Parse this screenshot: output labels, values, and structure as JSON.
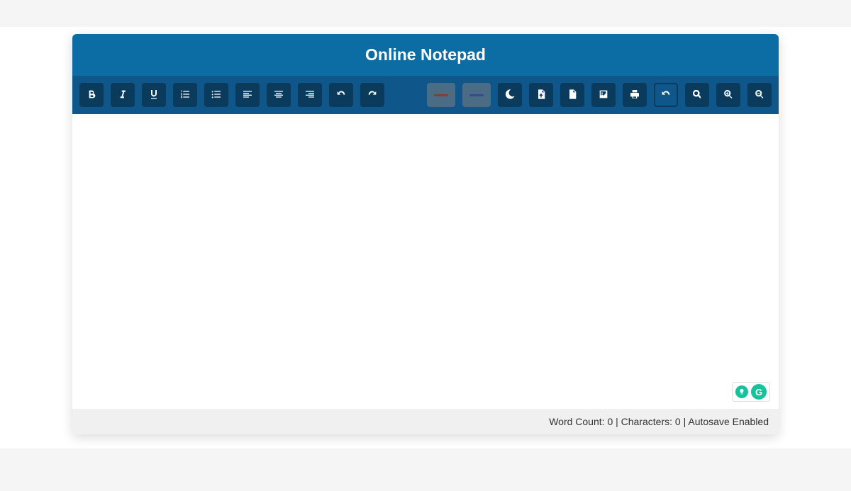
{
  "header": {
    "title": "Online Notepad"
  },
  "toolbar": {
    "left": [
      {
        "name": "bold-button",
        "icon": "bold-icon"
      },
      {
        "name": "italic-button",
        "icon": "italic-icon"
      },
      {
        "name": "underline-button",
        "icon": "underline-icon"
      },
      {
        "name": "ordered-list-button",
        "icon": "ordered-list-icon"
      },
      {
        "name": "unordered-list-button",
        "icon": "unordered-list-icon"
      },
      {
        "name": "align-left-button",
        "icon": "align-left-icon"
      },
      {
        "name": "align-center-button",
        "icon": "align-center-icon"
      },
      {
        "name": "align-right-button",
        "icon": "align-right-icon"
      },
      {
        "name": "undo-button",
        "icon": "undo-icon"
      },
      {
        "name": "redo-button",
        "icon": "redo-icon"
      }
    ],
    "right_colors": [
      {
        "name": "text-color-button",
        "icon": "text-color-icon",
        "swatch": "#8a3a3a"
      },
      {
        "name": "highlight-color-button",
        "icon": "highlight-color-icon",
        "swatch": "#3a4a8a"
      }
    ],
    "right": [
      {
        "name": "dark-mode-button",
        "icon": "moon-icon",
        "active": false
      },
      {
        "name": "download-txt-button",
        "icon": "file-download-icon",
        "active": false
      },
      {
        "name": "download-doc-button",
        "icon": "file-doc-icon",
        "active": false
      },
      {
        "name": "insert-image-button",
        "icon": "image-icon",
        "active": false
      },
      {
        "name": "print-button",
        "icon": "print-icon",
        "active": false
      },
      {
        "name": "reset-button",
        "icon": "reset-icon",
        "active": true
      },
      {
        "name": "zoom-button",
        "icon": "search-icon",
        "active": false
      },
      {
        "name": "zoom-in-button",
        "icon": "zoom-in-icon",
        "active": false
      },
      {
        "name": "zoom-out-button",
        "icon": "zoom-out-icon",
        "active": false
      }
    ]
  },
  "editor": {
    "value": ""
  },
  "status": {
    "wordcount_label": "Word Count: ",
    "wordcount_value": "0",
    "sep": " | ",
    "characters_label": "Characters: ",
    "characters_value": "0",
    "autosave_label": "Autosave Enabled"
  },
  "badges": {
    "g_label": "G"
  }
}
